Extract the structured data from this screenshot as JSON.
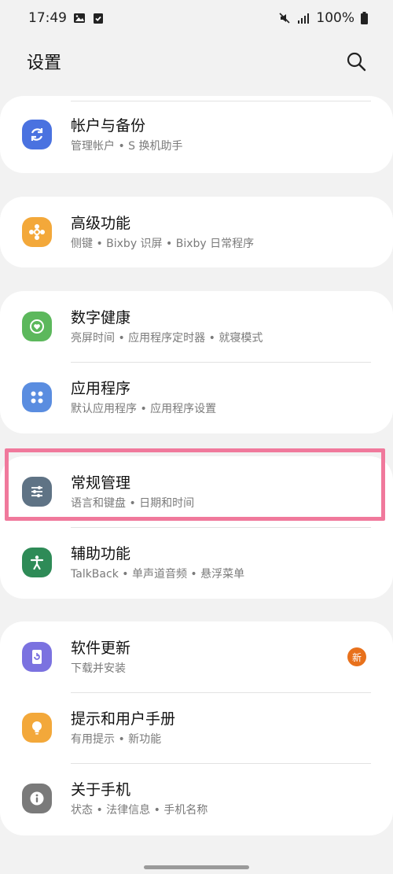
{
  "status_bar": {
    "time": "17:49",
    "battery": "100%"
  },
  "header": {
    "title": "设置"
  },
  "groups": [
    {
      "items": [
        {
          "title": "帐户与备份",
          "subtitle": "管理帐户 • S 换机助手",
          "icon": "sync-icon",
          "color": "#4a72e0"
        }
      ]
    },
    {
      "items": [
        {
          "title": "高级功能",
          "subtitle": "侧键 • Bixby 识屏 • Bixby 日常程序",
          "icon": "puzzle-gear-icon",
          "color": "#f3a83a"
        }
      ]
    },
    {
      "items": [
        {
          "title": "数字健康",
          "subtitle": "亮屏时间 • 应用程序定时器 • 就寝模式",
          "icon": "heart-circle-icon",
          "color": "#5cb85c"
        },
        {
          "title": "应用程序",
          "subtitle": "默认应用程序 • 应用程序设置",
          "icon": "apps-grid-icon",
          "color": "#5a8de0"
        }
      ]
    },
    {
      "items": [
        {
          "title": "常规管理",
          "subtitle": "语言和键盘 • 日期和时间",
          "icon": "sliders-icon",
          "color": "#5f7385"
        },
        {
          "title": "辅助功能",
          "subtitle": "TalkBack • 单声道音频 • 悬浮菜单",
          "icon": "accessibility-icon",
          "color": "#2e8b57"
        }
      ]
    },
    {
      "items": [
        {
          "title": "软件更新",
          "subtitle": "下载并安装",
          "icon": "update-icon",
          "color": "#7b72e0",
          "badge": "新"
        },
        {
          "title": "提示和用户手册",
          "subtitle": "有用提示 • 新功能",
          "icon": "lightbulb-icon",
          "color": "#f3a83a"
        },
        {
          "title": "关于手机",
          "subtitle": "状态 • 法律信息 • 手机名称",
          "icon": "info-icon",
          "color": "#7a7a7a"
        }
      ]
    }
  ],
  "colors": {
    "background": "#f2f2f2",
    "highlight": "#f0799c",
    "badge": "#e8711c"
  }
}
